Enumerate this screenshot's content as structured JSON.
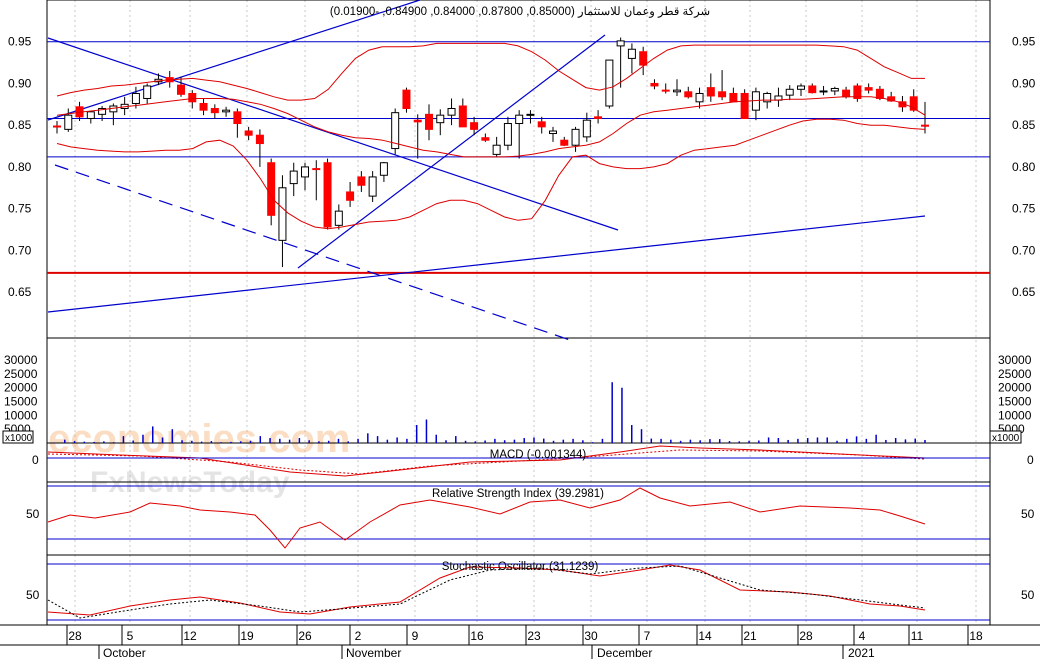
{
  "chart_data": {
    "type": "candlestick",
    "title": "شركة قطر وعمان للاستثمار (0.85000, 0.87800, 0.84000, 0.84900, -0.01900)",
    "price_axis": {
      "ticks": [
        "0.95",
        "0.90",
        "0.85",
        "0.80",
        "0.75",
        "0.70",
        "0.65"
      ],
      "ylim": [
        0.595,
        1.0
      ]
    },
    "volume_axis": {
      "ticks": [
        "30000",
        "25000",
        "20000",
        "15000",
        "10000",
        "5000"
      ],
      "unit_label": "x1000",
      "ylim": [
        0,
        38000
      ]
    },
    "x_ticks": [
      "28",
      "5",
      "12",
      "19",
      "26",
      "2",
      "9",
      "16",
      "23",
      "30",
      "7",
      "14",
      "21",
      "28",
      "4",
      "11",
      "18"
    ],
    "months": [
      "October",
      "November",
      "December",
      "2021"
    ],
    "horizontal_levels": [
      0.95,
      0.858,
      0.812
    ],
    "support_level": 0.673,
    "candles": [
      {
        "o": 0.849,
        "h": 0.855,
        "l": 0.84,
        "c": 0.848
      },
      {
        "o": 0.845,
        "h": 0.87,
        "l": 0.842,
        "c": 0.862
      },
      {
        "o": 0.872,
        "h": 0.878,
        "l": 0.855,
        "c": 0.86
      },
      {
        "o": 0.858,
        "h": 0.866,
        "l": 0.852,
        "c": 0.866
      },
      {
        "o": 0.863,
        "h": 0.873,
        "l": 0.855,
        "c": 0.87
      },
      {
        "o": 0.866,
        "h": 0.876,
        "l": 0.85,
        "c": 0.873
      },
      {
        "o": 0.87,
        "h": 0.884,
        "l": 0.862,
        "c": 0.875
      },
      {
        "o": 0.876,
        "h": 0.896,
        "l": 0.87,
        "c": 0.888
      },
      {
        "o": 0.882,
        "h": 0.9,
        "l": 0.875,
        "c": 0.897
      },
      {
        "o": 0.902,
        "h": 0.912,
        "l": 0.898,
        "c": 0.905
      },
      {
        "o": 0.907,
        "h": 0.915,
        "l": 0.895,
        "c": 0.902
      },
      {
        "o": 0.898,
        "h": 0.908,
        "l": 0.884,
        "c": 0.887
      },
      {
        "o": 0.888,
        "h": 0.892,
        "l": 0.87,
        "c": 0.878
      },
      {
        "o": 0.876,
        "h": 0.882,
        "l": 0.862,
        "c": 0.868
      },
      {
        "o": 0.87,
        "h": 0.875,
        "l": 0.858,
        "c": 0.865
      },
      {
        "o": 0.866,
        "h": 0.872,
        "l": 0.86,
        "c": 0.868
      },
      {
        "o": 0.866,
        "h": 0.87,
        "l": 0.835,
        "c": 0.852
      },
      {
        "o": 0.843,
        "h": 0.848,
        "l": 0.832,
        "c": 0.838
      },
      {
        "o": 0.838,
        "h": 0.845,
        "l": 0.8,
        "c": 0.828
      },
      {
        "o": 0.805,
        "h": 0.81,
        "l": 0.73,
        "c": 0.742
      },
      {
        "o": 0.712,
        "h": 0.79,
        "l": 0.68,
        "c": 0.775
      },
      {
        "o": 0.78,
        "h": 0.805,
        "l": 0.765,
        "c": 0.795
      },
      {
        "o": 0.788,
        "h": 0.805,
        "l": 0.772,
        "c": 0.8
      },
      {
        "o": 0.798,
        "h": 0.808,
        "l": 0.76,
        "c": 0.797
      },
      {
        "o": 0.805,
        "h": 0.81,
        "l": 0.725,
        "c": 0.728
      },
      {
        "o": 0.73,
        "h": 0.755,
        "l": 0.725,
        "c": 0.747
      },
      {
        "o": 0.77,
        "h": 0.782,
        "l": 0.752,
        "c": 0.76
      },
      {
        "o": 0.788,
        "h": 0.795,
        "l": 0.77,
        "c": 0.778
      },
      {
        "o": 0.765,
        "h": 0.795,
        "l": 0.758,
        "c": 0.788
      },
      {
        "o": 0.79,
        "h": 0.806,
        "l": 0.782,
        "c": 0.805
      },
      {
        "o": 0.822,
        "h": 0.87,
        "l": 0.815,
        "c": 0.865
      },
      {
        "o": 0.892,
        "h": 0.895,
        "l": 0.865,
        "c": 0.87
      },
      {
        "o": 0.856,
        "h": 0.863,
        "l": 0.81,
        "c": 0.854
      },
      {
        "o": 0.863,
        "h": 0.875,
        "l": 0.832,
        "c": 0.845
      },
      {
        "o": 0.853,
        "h": 0.869,
        "l": 0.838,
        "c": 0.862
      },
      {
        "o": 0.862,
        "h": 0.882,
        "l": 0.85,
        "c": 0.87
      },
      {
        "o": 0.873,
        "h": 0.882,
        "l": 0.848,
        "c": 0.848
      },
      {
        "o": 0.853,
        "h": 0.86,
        "l": 0.838,
        "c": 0.845
      },
      {
        "o": 0.835,
        "h": 0.84,
        "l": 0.83,
        "c": 0.832
      },
      {
        "o": 0.815,
        "h": 0.836,
        "l": 0.812,
        "c": 0.826
      },
      {
        "o": 0.826,
        "h": 0.86,
        "l": 0.82,
        "c": 0.852
      },
      {
        "o": 0.852,
        "h": 0.868,
        "l": 0.81,
        "c": 0.862
      },
      {
        "o": 0.862,
        "h": 0.868,
        "l": 0.852,
        "c": 0.863
      },
      {
        "o": 0.854,
        "h": 0.86,
        "l": 0.84,
        "c": 0.848
      },
      {
        "o": 0.84,
        "h": 0.848,
        "l": 0.83,
        "c": 0.843
      },
      {
        "o": 0.832,
        "h": 0.836,
        "l": 0.825,
        "c": 0.826
      },
      {
        "o": 0.826,
        "h": 0.848,
        "l": 0.818,
        "c": 0.845
      },
      {
        "o": 0.836,
        "h": 0.865,
        "l": 0.83,
        "c": 0.856
      },
      {
        "o": 0.86,
        "h": 0.868,
        "l": 0.852,
        "c": 0.858
      },
      {
        "o": 0.873,
        "h": 0.928,
        "l": 0.87,
        "c": 0.928
      },
      {
        "o": 0.945,
        "h": 0.955,
        "l": 0.895,
        "c": 0.951
      },
      {
        "o": 0.93,
        "h": 0.948,
        "l": 0.912,
        "c": 0.941
      },
      {
        "o": 0.938,
        "h": 0.944,
        "l": 0.91,
        "c": 0.922
      },
      {
        "o": 0.9,
        "h": 0.905,
        "l": 0.893,
        "c": 0.897
      },
      {
        "o": 0.892,
        "h": 0.9,
        "l": 0.888,
        "c": 0.891
      },
      {
        "o": 0.89,
        "h": 0.905,
        "l": 0.885,
        "c": 0.892
      },
      {
        "o": 0.89,
        "h": 0.896,
        "l": 0.882,
        "c": 0.884
      },
      {
        "o": 0.878,
        "h": 0.895,
        "l": 0.87,
        "c": 0.888
      },
      {
        "o": 0.895,
        "h": 0.912,
        "l": 0.878,
        "c": 0.885
      },
      {
        "o": 0.89,
        "h": 0.916,
        "l": 0.88,
        "c": 0.884
      },
      {
        "o": 0.888,
        "h": 0.895,
        "l": 0.878,
        "c": 0.878
      },
      {
        "o": 0.888,
        "h": 0.893,
        "l": 0.858,
        "c": 0.858
      },
      {
        "o": 0.868,
        "h": 0.895,
        "l": 0.856,
        "c": 0.89
      },
      {
        "o": 0.878,
        "h": 0.89,
        "l": 0.87,
        "c": 0.888
      },
      {
        "o": 0.88,
        "h": 0.895,
        "l": 0.872,
        "c": 0.885
      },
      {
        "o": 0.886,
        "h": 0.898,
        "l": 0.88,
        "c": 0.893
      },
      {
        "o": 0.893,
        "h": 0.9,
        "l": 0.885,
        "c": 0.897
      },
      {
        "o": 0.897,
        "h": 0.9,
        "l": 0.888,
        "c": 0.889
      },
      {
        "o": 0.89,
        "h": 0.897,
        "l": 0.886,
        "c": 0.891
      },
      {
        "o": 0.891,
        "h": 0.896,
        "l": 0.886,
        "c": 0.894
      },
      {
        "o": 0.892,
        "h": 0.896,
        "l": 0.882,
        "c": 0.884
      },
      {
        "o": 0.897,
        "h": 0.9,
        "l": 0.878,
        "c": 0.882
      },
      {
        "o": 0.895,
        "h": 0.9,
        "l": 0.888,
        "c": 0.892
      },
      {
        "o": 0.893,
        "h": 0.897,
        "l": 0.88,
        "c": 0.882
      },
      {
        "o": 0.884,
        "h": 0.89,
        "l": 0.878,
        "c": 0.879
      },
      {
        "o": 0.878,
        "h": 0.885,
        "l": 0.866,
        "c": 0.872
      },
      {
        "o": 0.884,
        "h": 0.893,
        "l": 0.866,
        "c": 0.868
      },
      {
        "o": 0.85,
        "h": 0.878,
        "l": 0.84,
        "c": 0.849
      }
    ],
    "volume": [
      200,
      1200,
      700,
      500,
      400,
      600,
      300,
      2500,
      900,
      3000,
      6000,
      2000,
      5000,
      1000,
      800,
      500,
      700,
      300,
      400,
      600,
      800,
      2500,
      1800,
      1500,
      1200,
      1800,
      1000,
      600,
      800,
      1500,
      600,
      1500,
      3500,
      2500,
      1200,
      2000,
      1500,
      6500,
      8500,
      3000,
      1000,
      2500,
      800,
      600,
      900,
      1500,
      1000,
      1200,
      1800,
      2000,
      1600,
      800,
      1200,
      1500,
      1000,
      300,
      1500,
      22000,
      20000,
      6500,
      5000,
      1600,
      1500,
      1200,
      800,
      1200,
      1000,
      1400,
      1400,
      700,
      600,
      800,
      900,
      2000,
      1800,
      1100,
      1500,
      1800,
      2000,
      2000,
      800,
      1500,
      2400,
      1500,
      3000,
      1100,
      1800,
      1300,
      1600,
      1100
    ],
    "bollinger_upper": [
      0.885,
      0.889,
      0.892,
      0.894,
      0.897,
      0.898,
      0.9,
      0.902,
      0.904,
      0.905,
      0.906,
      0.904,
      0.902,
      0.898,
      0.894,
      0.889,
      0.884,
      0.88,
      0.88,
      0.882,
      0.893,
      0.912,
      0.93,
      0.94,
      0.944,
      0.944,
      0.944,
      0.945,
      0.948,
      0.948,
      0.948,
      0.948,
      0.948,
      0.948,
      0.945,
      0.938,
      0.928,
      0.915,
      0.905,
      0.895,
      0.892,
      0.896,
      0.906,
      0.918,
      0.93,
      0.94,
      0.945,
      0.946,
      0.946,
      0.946,
      0.946,
      0.946,
      0.946,
      0.946,
      0.946,
      0.946,
      0.946,
      0.945,
      0.944,
      0.94,
      0.93,
      0.92,
      0.913,
      0.906,
      0.906
    ],
    "bollinger_middle": [
      0.862,
      0.864,
      0.866,
      0.868,
      0.87,
      0.872,
      0.874,
      0.876,
      0.878,
      0.88,
      0.882,
      0.882,
      0.882,
      0.881,
      0.878,
      0.875,
      0.87,
      0.864,
      0.856,
      0.848,
      0.842,
      0.838,
      0.835,
      0.834,
      0.832,
      0.828,
      0.824,
      0.82,
      0.818,
      0.815,
      0.812,
      0.812,
      0.812,
      0.812,
      0.813,
      0.815,
      0.818,
      0.822,
      0.824,
      0.826,
      0.83,
      0.84,
      0.852,
      0.862,
      0.866,
      0.868,
      0.87,
      0.872,
      0.874,
      0.876,
      0.878,
      0.879,
      0.88,
      0.88,
      0.881,
      0.881,
      0.882,
      0.883,
      0.884,
      0.884,
      0.884,
      0.882,
      0.878,
      0.872,
      0.862
    ],
    "bollinger_lower": [
      0.828,
      0.824,
      0.822,
      0.82,
      0.819,
      0.818,
      0.818,
      0.819,
      0.82,
      0.82,
      0.822,
      0.83,
      0.832,
      0.825,
      0.808,
      0.786,
      0.76,
      0.745,
      0.735,
      0.728,
      0.726,
      0.728,
      0.731,
      0.734,
      0.735,
      0.736,
      0.74,
      0.748,
      0.756,
      0.76,
      0.76,
      0.756,
      0.748,
      0.74,
      0.736,
      0.738,
      0.76,
      0.79,
      0.812,
      0.814,
      0.804,
      0.8,
      0.798,
      0.798,
      0.8,
      0.804,
      0.814,
      0.82,
      0.822,
      0.824,
      0.826,
      0.832,
      0.838,
      0.844,
      0.85,
      0.855,
      0.857,
      0.857,
      0.856,
      0.852,
      0.85,
      0.85,
      0.848,
      0.846,
      0.845
    ],
    "macd": {
      "label": "MACD (-0.001344)"
    },
    "rsi": {
      "label": "Relative Strength Index (39.2981)",
      "ticks": [
        "50"
      ]
    },
    "stochastic": {
      "label": "Stochastic Oscillator (31.1239)",
      "ticks": [
        "50"
      ]
    },
    "watermarks": [
      "economies.com",
      "FxNewsToday"
    ],
    "colors": {
      "bull": "#ffffff",
      "bear": "#ff0000",
      "outline": "#000000",
      "blue": "#0000cc",
      "red": "#dd0000",
      "grid": "#c8c8c8"
    }
  }
}
